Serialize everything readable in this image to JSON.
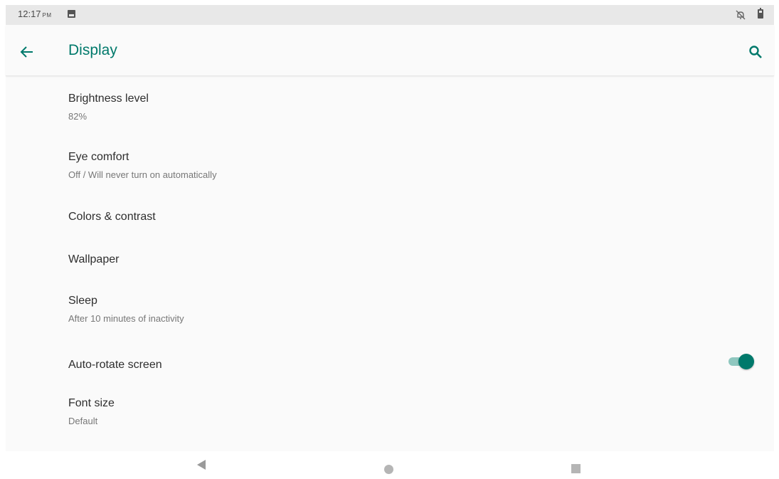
{
  "status_bar": {
    "time": "12:17",
    "ampm": "PM",
    "icons": [
      "image-notification-icon",
      "do-not-disturb-icon",
      "battery-icon"
    ]
  },
  "app_bar": {
    "title": "Display",
    "back_icon": "arrow-back-icon",
    "search_icon": "search-icon"
  },
  "settings": [
    {
      "title": "Brightness level",
      "summary": "82%"
    },
    {
      "title": "Eye comfort",
      "summary": "Off / Will never turn on automatically"
    },
    {
      "title": "Colors & contrast"
    },
    {
      "title": "Wallpaper"
    },
    {
      "title": "Sleep",
      "summary": "After 10 minutes of inactivity"
    },
    {
      "title": "Auto-rotate screen",
      "toggle": "on"
    },
    {
      "title": "Font size",
      "summary": "Default"
    }
  ],
  "nav_bar": [
    "back-triangle-icon",
    "home-circle-icon",
    "recents-square-icon"
  ],
  "colors": {
    "accent": "#00796b",
    "toggle_track": "#8fc7bf",
    "background": "#fafafa"
  }
}
